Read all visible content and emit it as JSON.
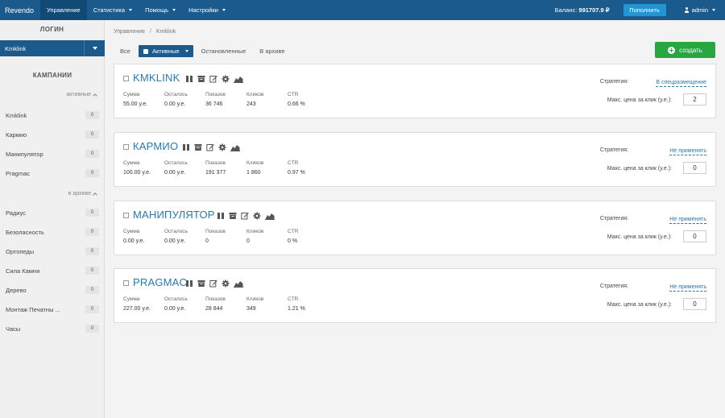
{
  "app": {
    "brand": "Revendo"
  },
  "topnav": [
    {
      "label": "Управление",
      "active": true,
      "dropdown": false
    },
    {
      "label": "Статистика",
      "active": false,
      "dropdown": true
    },
    {
      "label": "Помощь",
      "active": false,
      "dropdown": true
    },
    {
      "label": "Настройки",
      "active": false,
      "dropdown": true
    }
  ],
  "balance": {
    "label": "Баланс:",
    "value": "991707.9 ₽"
  },
  "topup_label": "Пополнить",
  "user": {
    "name": "admin"
  },
  "sidebar": {
    "login_header": "ЛОГИН",
    "login_value": "Kmklink",
    "campaigns_header": "КАМПАНИИ",
    "active_label": "активные",
    "archive_label": "в архиве",
    "active_items": [
      {
        "name": "Kmklink",
        "count": "0"
      },
      {
        "name": "Кармио",
        "count": "0"
      },
      {
        "name": "Манипулятор",
        "count": "0"
      },
      {
        "name": "Pragmac",
        "count": "0"
      }
    ],
    "archive_items": [
      {
        "name": "Радиус",
        "count": "0"
      },
      {
        "name": "Безопасность",
        "count": "0"
      },
      {
        "name": "Ортопеды",
        "count": "0"
      },
      {
        "name": "Сила Камня",
        "count": "0"
      },
      {
        "name": "Дерево",
        "count": "0"
      },
      {
        "name": "Монтаж Печатны ...",
        "count": "0"
      },
      {
        "name": "Часы",
        "count": "0"
      }
    ]
  },
  "breadcrumb": {
    "root": "Управление",
    "sep": "/",
    "current": "Kmklink"
  },
  "filters": {
    "all": "Все",
    "active": "Активные",
    "stopped": "Остановленные",
    "archive": "В архиве"
  },
  "create_label": "создать",
  "stat_labels": {
    "sum": "Сумма",
    "left": "Осталось",
    "shows": "Показов",
    "clicks": "Кликов",
    "ctr": "CTR"
  },
  "strategy_label": "Стратегия:",
  "max_price_label": "Макс. цена за клик (у.е.):",
  "campaigns": [
    {
      "title": "KMKLINK",
      "sum": "55.00 у.е.",
      "left": "0.00 у.е.",
      "shows": "36 746",
      "clicks": "243",
      "ctr": "0.66 %",
      "strategy": "В спецразмещение",
      "max_price": "2"
    },
    {
      "title": "КАРМИО",
      "sum": "100.00 у.е.",
      "left": "0.00 у.е.",
      "shows": "191 377",
      "clicks": "1 860",
      "ctr": "0.97 %",
      "strategy": "Не применять",
      "max_price": "0"
    },
    {
      "title": "МАНИПУЛЯТОР",
      "sum": "0.00 у.е.",
      "left": "0.00 у.е.",
      "shows": "0",
      "clicks": "0",
      "ctr": "0 %",
      "strategy": "Не применять",
      "max_price": "0"
    },
    {
      "title": "PRAGMAC",
      "sum": "227.00 у.е.",
      "left": "0.00 у.е.",
      "shows": "28 844",
      "clicks": "349",
      "ctr": "1.21 %",
      "strategy": "Не применять",
      "max_price": "0"
    }
  ],
  "colors": {
    "nav": "#1a5a8c",
    "accent": "#2878b3",
    "create": "#27a641",
    "topup": "#2196d3"
  }
}
